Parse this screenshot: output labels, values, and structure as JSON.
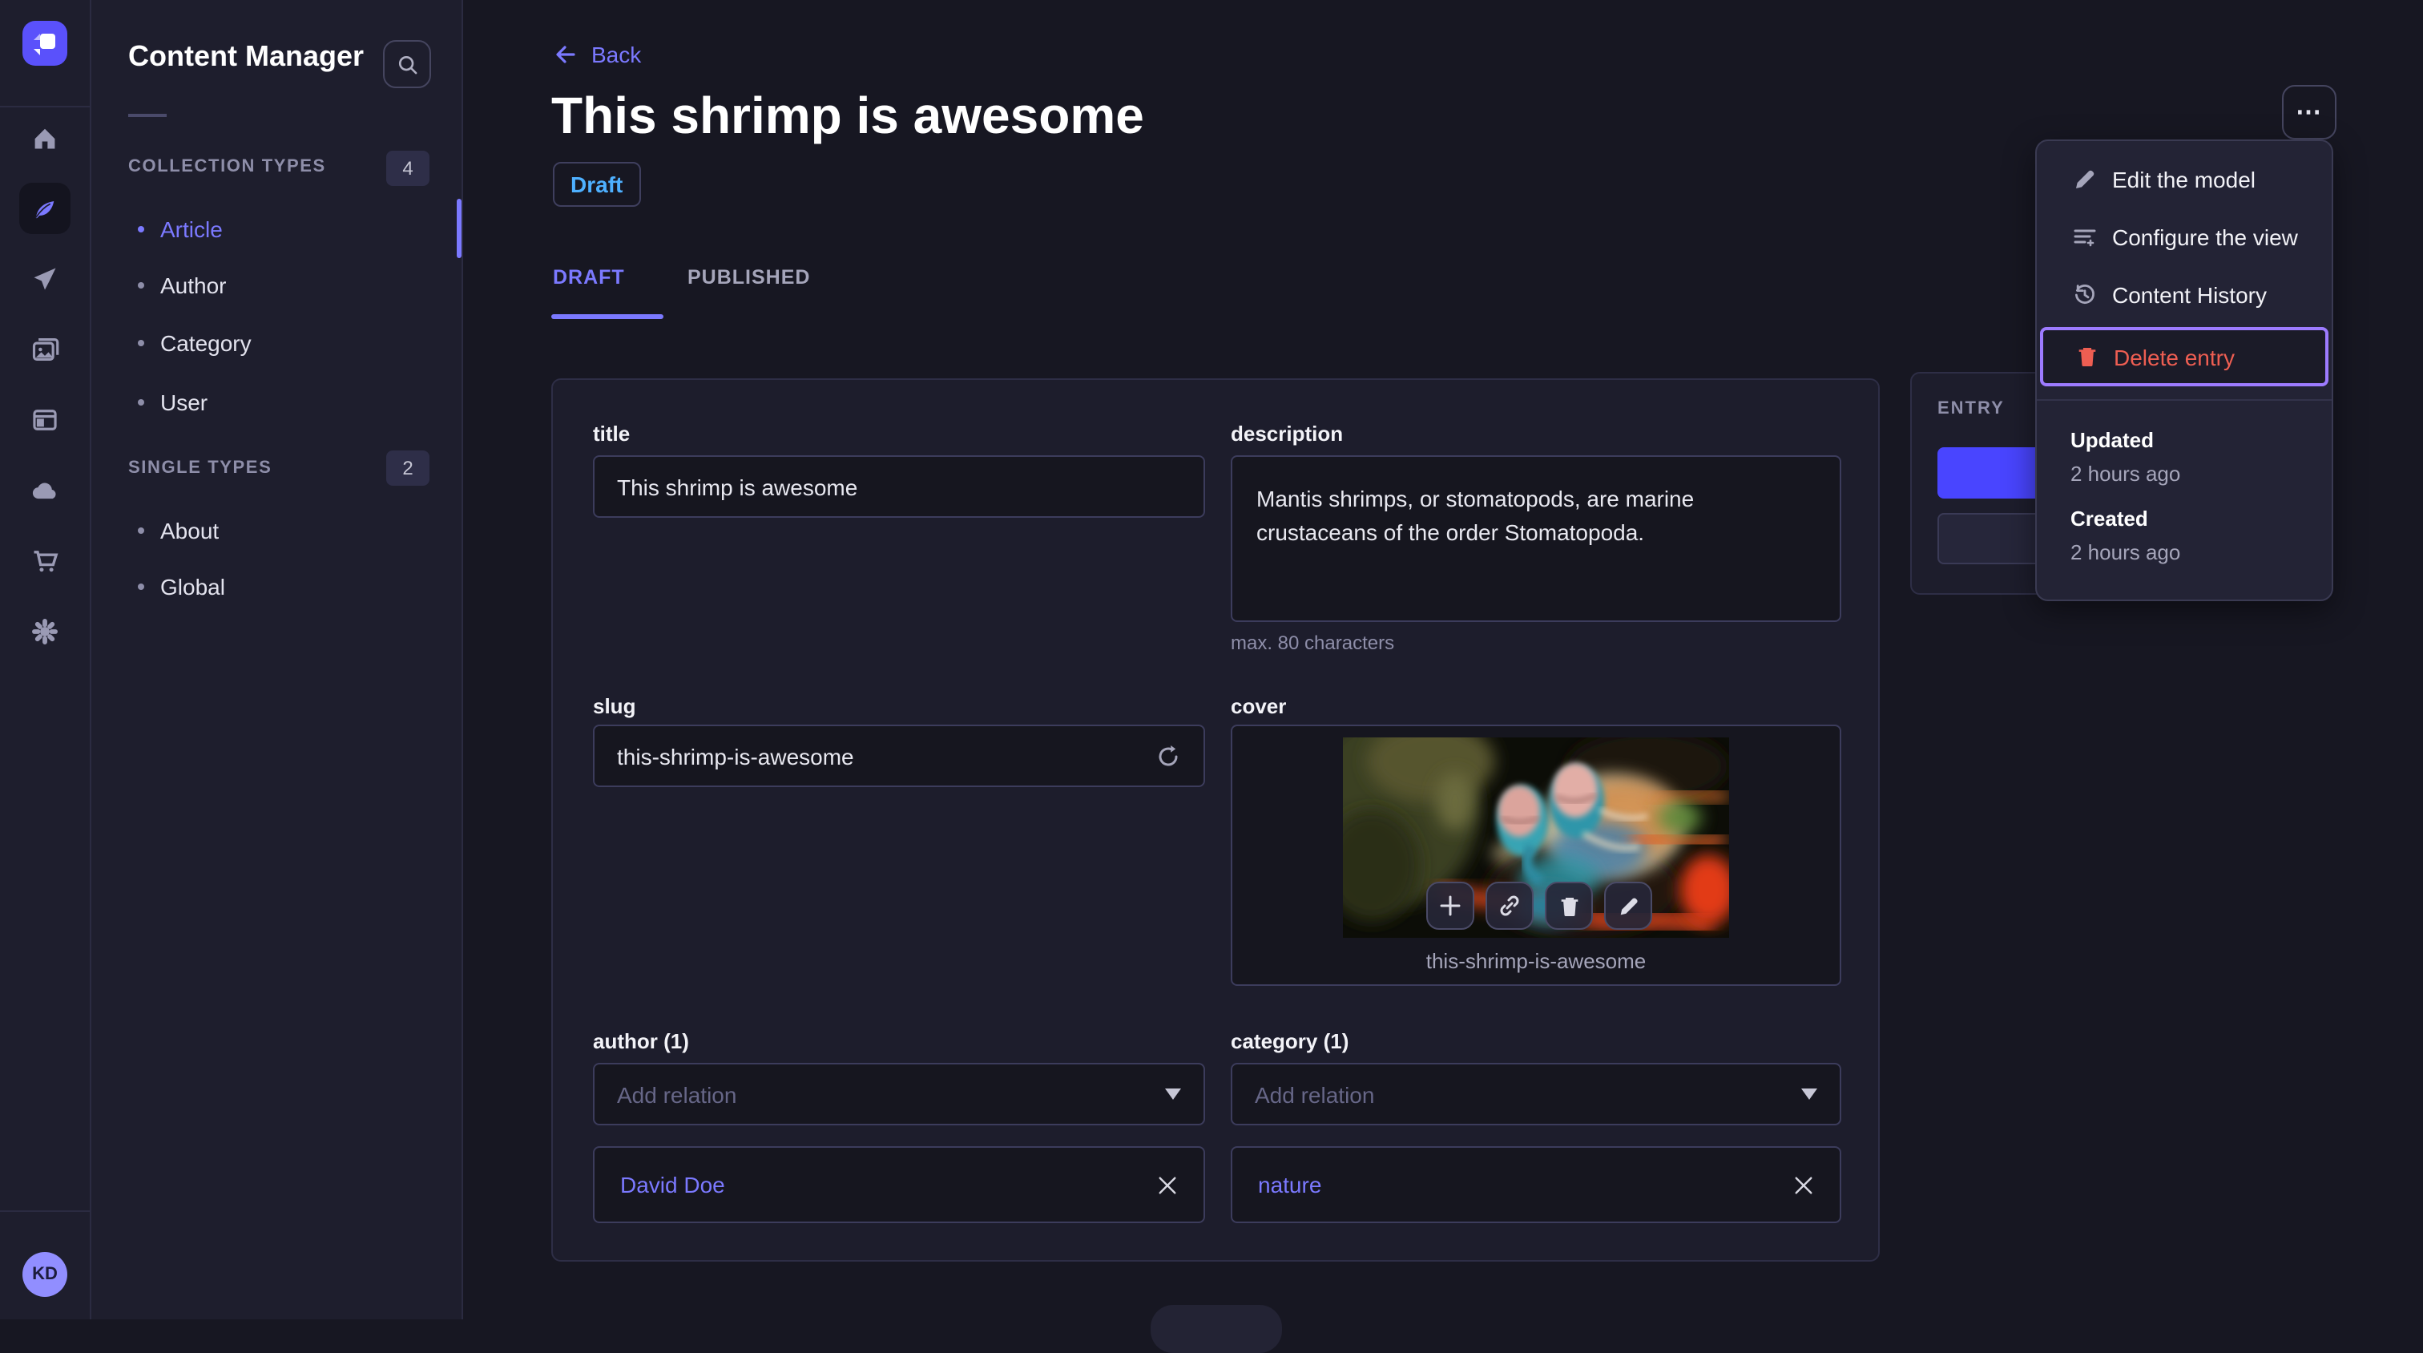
{
  "user": {
    "initials": "KD"
  },
  "rail_icons": [
    "strapi-logo",
    "home-icon",
    "content-manager-feather-icon",
    "releases-send-icon",
    "media-library-icon",
    "content-type-builder-icon",
    "deploy-cloud-icon",
    "marketplace-cart-icon",
    "settings-gear-icon"
  ],
  "sidebar": {
    "title": "Content Manager",
    "search_icon": "search-icon",
    "sections": [
      {
        "label": "COLLECTION TYPES",
        "count": "4",
        "items": [
          {
            "label": "Article",
            "active": true
          },
          {
            "label": "Author"
          },
          {
            "label": "Category"
          },
          {
            "label": "User"
          }
        ]
      },
      {
        "label": "SINGLE TYPES",
        "count": "2",
        "items": [
          {
            "label": "About"
          },
          {
            "label": "Global"
          }
        ]
      }
    ]
  },
  "header": {
    "back_label": "Back",
    "title": "This shrimp is awesome",
    "status": "Draft",
    "tabs": [
      {
        "label": "DRAFT",
        "active": true
      },
      {
        "label": "PUBLISHED",
        "active": false
      }
    ],
    "more_label": "⋯"
  },
  "menu": {
    "items": [
      {
        "icon": "pencil-icon",
        "label": "Edit the model"
      },
      {
        "icon": "configure-list-icon",
        "label": "Configure the view"
      },
      {
        "icon": "history-clock-icon",
        "label": "Content History"
      },
      {
        "icon": "trash-icon",
        "label": "Delete entry",
        "danger": true,
        "focused": true
      }
    ],
    "meta": [
      {
        "label": "Updated",
        "value": "2 hours ago"
      },
      {
        "label": "Created",
        "value": "2 hours ago"
      }
    ]
  },
  "entry_panel": {
    "label": "ENTRY"
  },
  "form": {
    "title": {
      "label": "title",
      "value": "This shrimp is awesome"
    },
    "description": {
      "label": "description",
      "value": "Mantis shrimps, or stomatopods, are marine crustaceans of the order Stomatopoda.",
      "hint": "max. 80 characters"
    },
    "slug": {
      "label": "slug",
      "value": "this-shrimp-is-awesome",
      "action_icon": "regenerate-icon"
    },
    "cover": {
      "label": "cover",
      "caption": "this-shrimp-is-awesome",
      "asset_actions": [
        "add-asset-icon",
        "copy-link-icon",
        "delete-asset-icon",
        "edit-asset-icon"
      ]
    },
    "author": {
      "label": "author (1)",
      "placeholder": "Add relation",
      "relation": "David Doe"
    },
    "category": {
      "label": "category (1)",
      "placeholder": "Add relation",
      "relation": "nature"
    }
  },
  "colors": {
    "accent_purple": "#7b79ff",
    "primary_blue": "#4945ff",
    "draft_blue": "#4eb0ff",
    "danger_red": "#ee5e52",
    "focus_ring": "#9d7bff",
    "sidebar_bg": "#1e1e2d",
    "main_bg": "#171722",
    "card_bg": "#1d1d2c"
  }
}
